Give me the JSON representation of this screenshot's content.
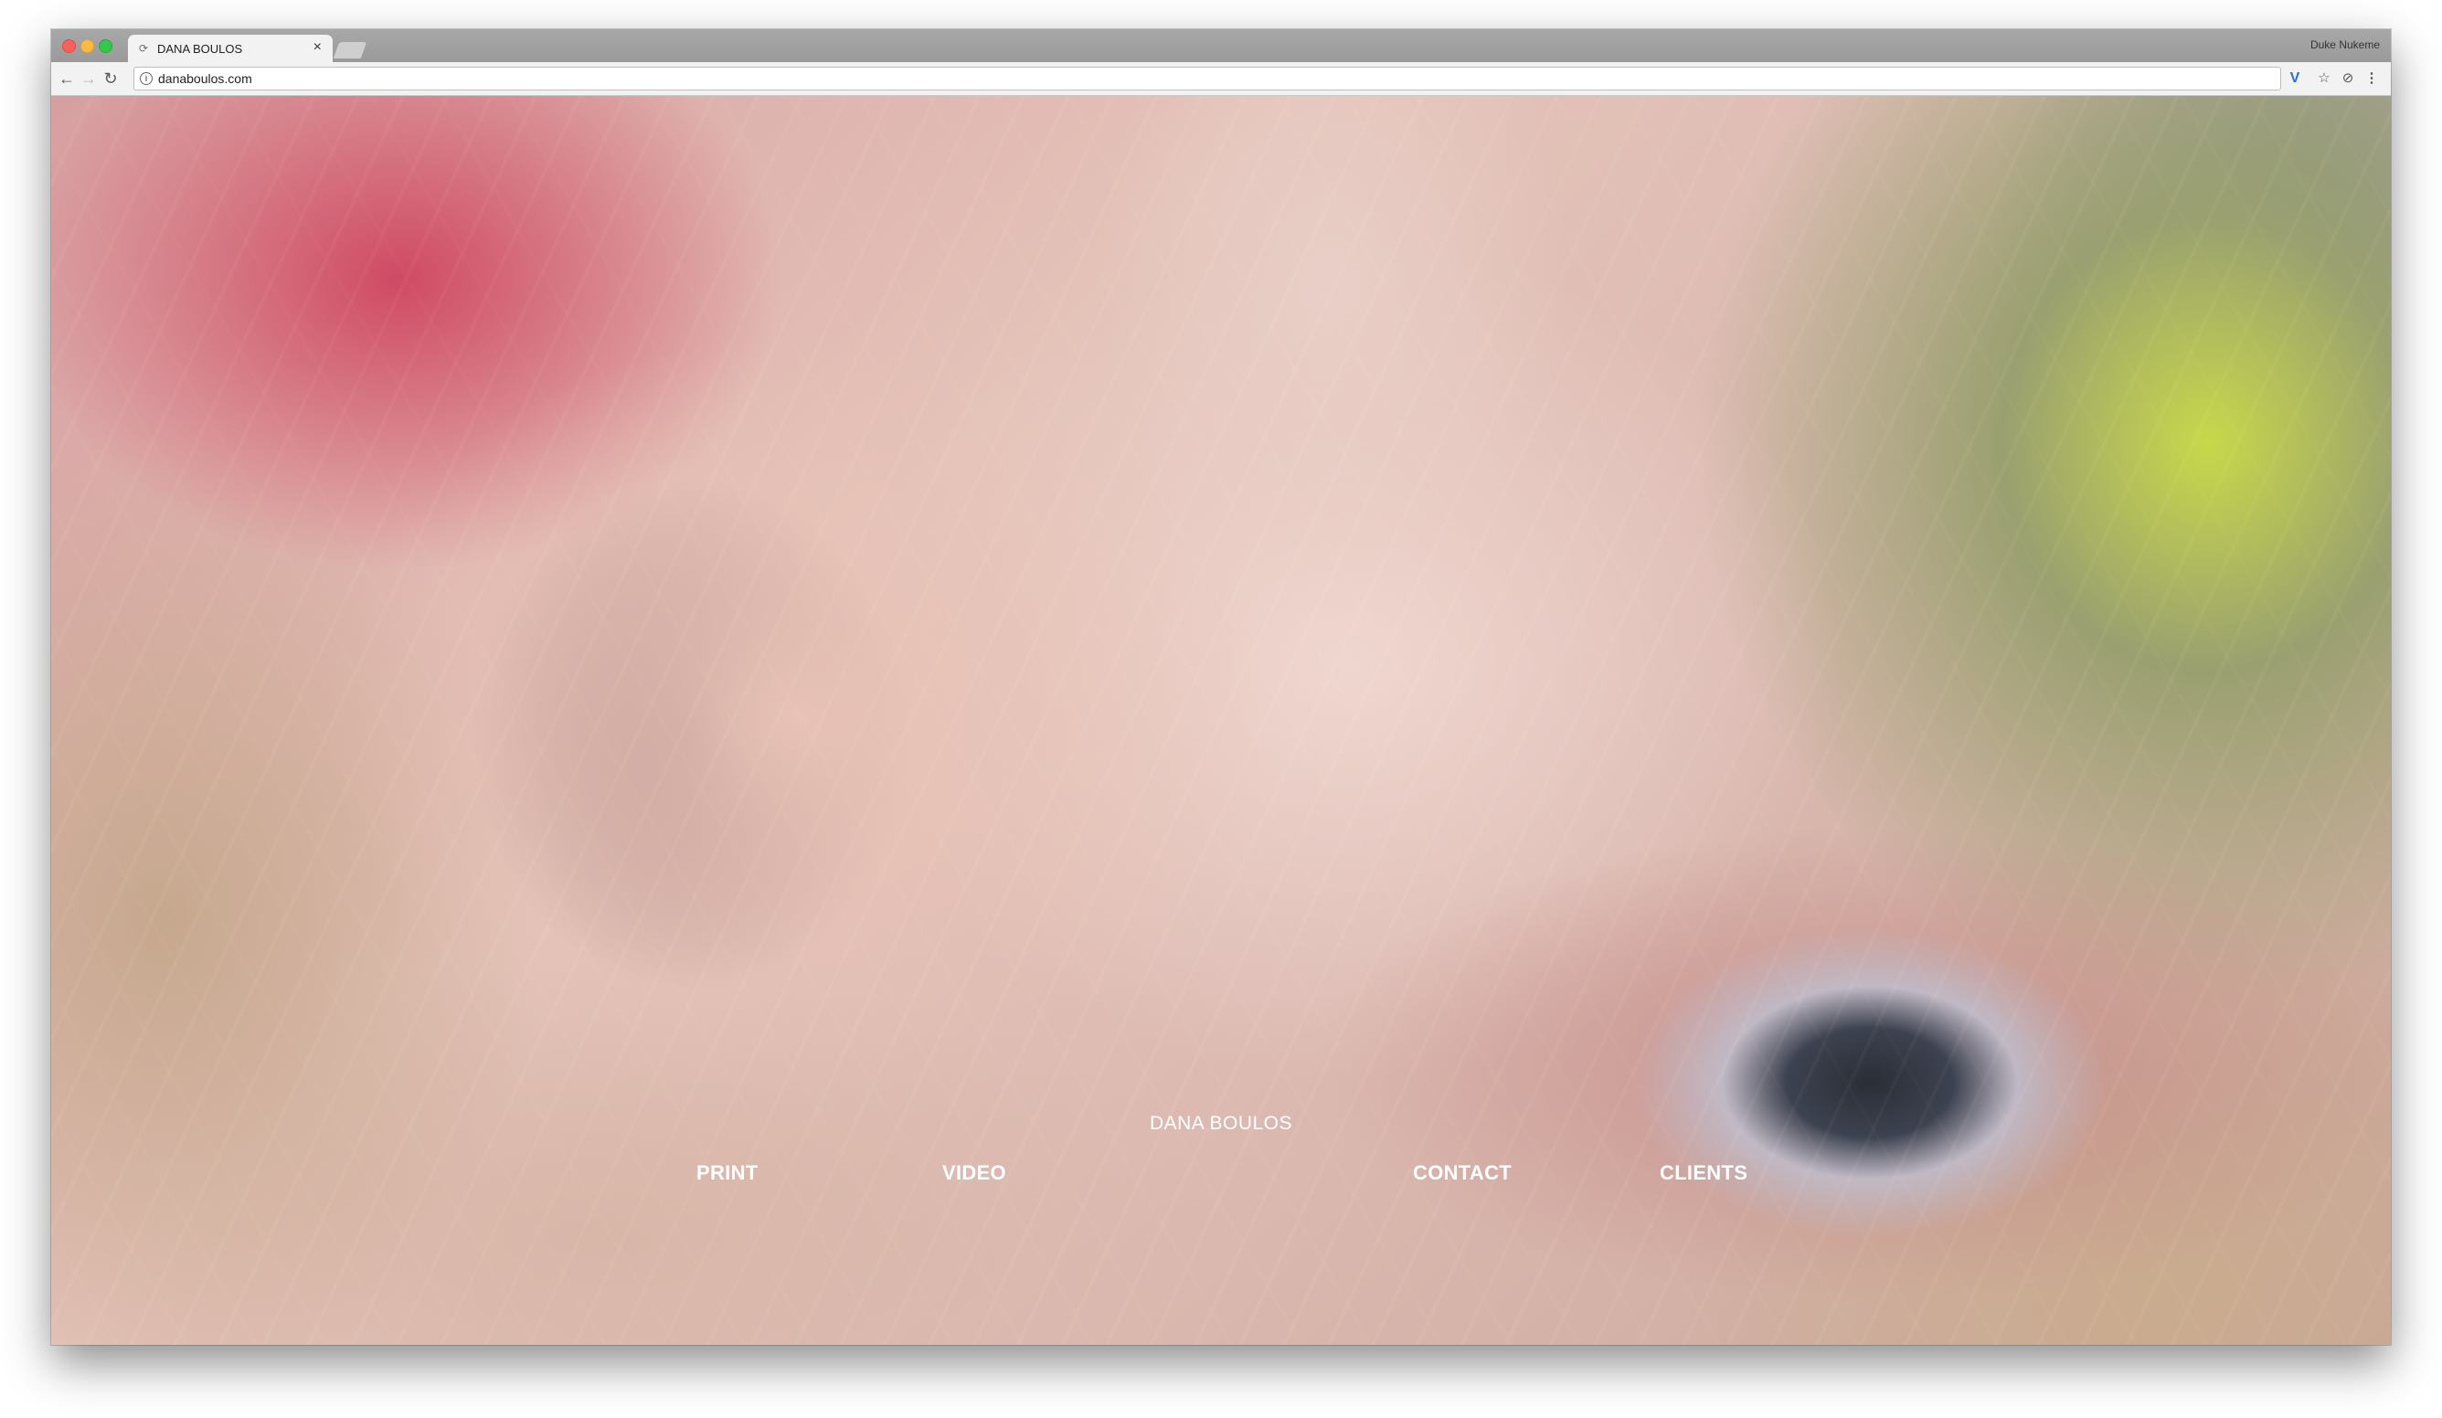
{
  "browser": {
    "tab": {
      "title": "DANA BOULOS",
      "favicon": "loading-icon",
      "close_glyph": "×"
    },
    "profile_name": "Duke Nukeme",
    "address_bar": {
      "url": "danaboulos.com"
    },
    "toolbar_icons": [
      "back-arrow-icon",
      "forward-arrow-icon",
      "reload-icon",
      "info-icon",
      "extension-v-icon",
      "star-icon",
      "extension-icon",
      "menu-icon"
    ]
  },
  "site": {
    "title": "DANA BOULOS",
    "nav": {
      "print": "PRINT",
      "video": "VIDEO",
      "contact": "CONTACT",
      "clients": "CLIENTS"
    }
  },
  "colors": {
    "nav_text": "#ffffff",
    "close_button": "#fc605c",
    "minimize_button": "#fdbc40",
    "maximize_button": "#34c84a",
    "extension_accent": "#2a6fd8"
  }
}
